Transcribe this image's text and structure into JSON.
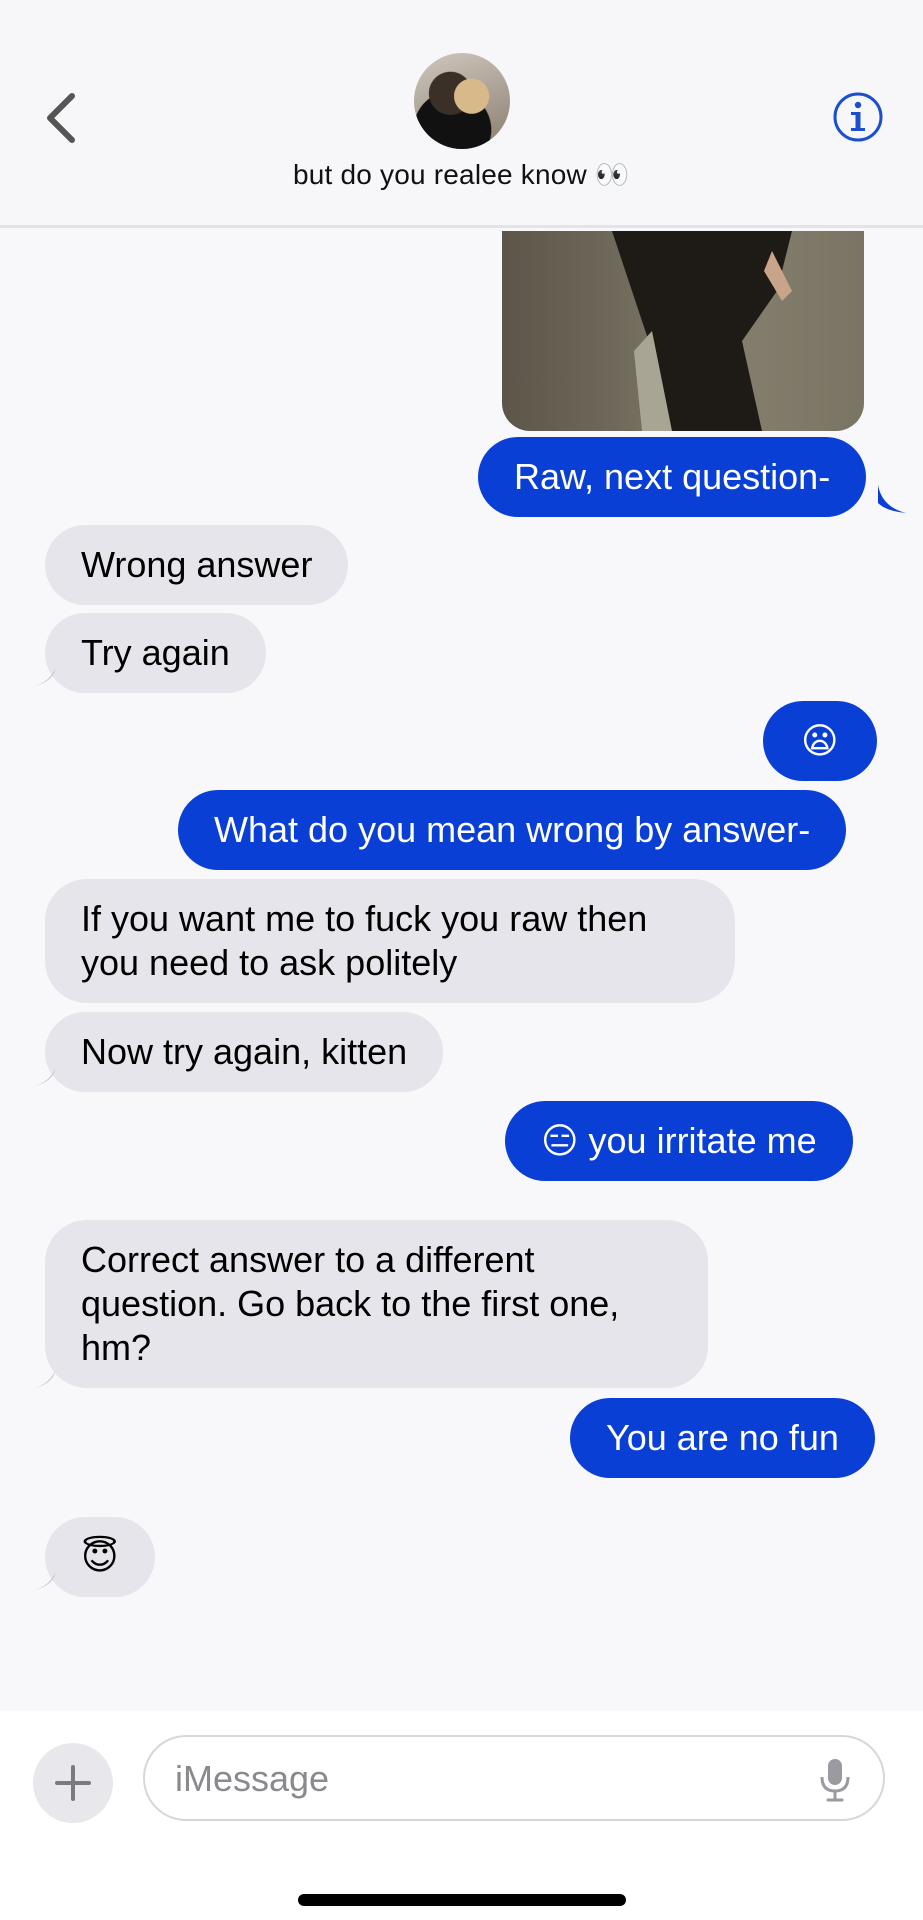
{
  "header": {
    "contact_name": "but do you realee know 👀"
  },
  "messages": [
    {
      "from": "me",
      "text": "Raw, next question-"
    },
    {
      "from": "them",
      "text": "Wrong answer"
    },
    {
      "from": "them",
      "text": "Try again"
    },
    {
      "from": "me",
      "text": "😦"
    },
    {
      "from": "me",
      "text": "What do you mean wrong by answer-"
    },
    {
      "from": "them",
      "text": "If you want me to fuck you raw then you need to ask politely"
    },
    {
      "from": "them",
      "text": "Now try again, kitten"
    },
    {
      "from": "me",
      "text": "😑 you irritate me"
    },
    {
      "from": "them",
      "text": "Correct answer to a different question. Go back to the first one, hm?"
    },
    {
      "from": "me",
      "text": "You are no fun"
    },
    {
      "from": "them",
      "text": "😇"
    }
  ],
  "composer": {
    "placeholder": "iMessage"
  },
  "colors": {
    "outgoing_bubble": "#0a3fd6",
    "incoming_bubble": "#e6e5eb",
    "accent": "#1a4fd0"
  },
  "icons": {
    "back": "chevron-left-icon",
    "info": "info-icon",
    "add": "plus-icon",
    "mic": "microphone-icon"
  }
}
